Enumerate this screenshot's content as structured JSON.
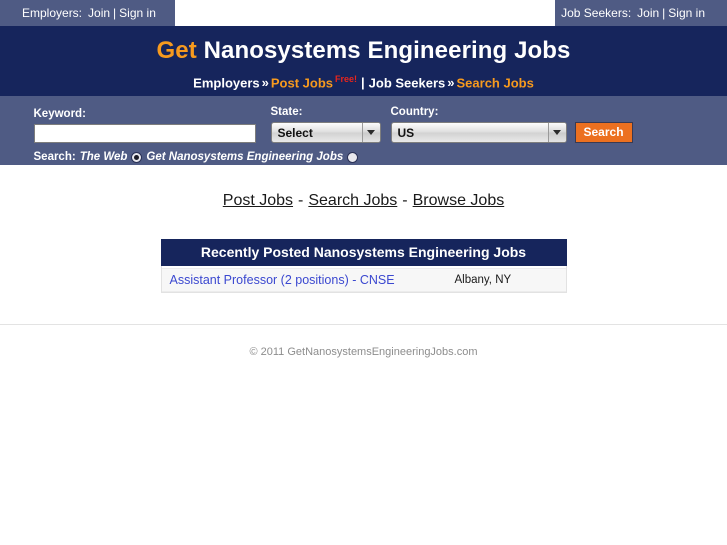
{
  "topbar": {
    "employers": {
      "prefix": "Employers:",
      "join": "Join",
      "separator": "|",
      "signin": "Sign in"
    },
    "jobseekers": {
      "prefix": "Job Seekers:",
      "join": "Join",
      "separator": "|",
      "signin": "Sign in"
    }
  },
  "masthead": {
    "title_accent": "Get",
    "title_rest": " Nanosystems Engineering Jobs",
    "nav": {
      "employers": "Employers",
      "chevron1": "»",
      "post_jobs": "Post Jobs",
      "free_badge": "Free!",
      "pipe": "|",
      "job_seekers": "Job Seekers",
      "chevron2": "»",
      "search_jobs": "Search Jobs"
    }
  },
  "search": {
    "keyword_label": "Keyword:",
    "keyword_value": "",
    "keyword_placeholder": "",
    "state_label": "State:",
    "state_value": "Select",
    "state_options": [
      "Select"
    ],
    "country_label": "Country:",
    "country_value": "US",
    "country_options": [
      "US"
    ],
    "search_button": "Search",
    "scope_prefix": "Search:",
    "scope_web": "The Web",
    "scope_site": "Get Nanosystems Engineering Jobs",
    "scope_web_selected": true,
    "scope_site_selected": false
  },
  "quicknav": {
    "post_jobs": "Post Jobs",
    "dash1": "-",
    "search_jobs": "Search Jobs",
    "dash2": "-",
    "browse_jobs": "Browse Jobs"
  },
  "recent": {
    "heading": "Recently Posted Nanosystems Engineering Jobs",
    "jobs": [
      {
        "title": "Assistant Professor (2 positions) - CNSE",
        "location": "Albany, NY"
      }
    ]
  },
  "footer": {
    "copyright": "© 2011 GetNanosystemsEngineeringJobs.com"
  },
  "colors": {
    "navy": "#16255c",
    "slate": "#4f5b84",
    "orange": "#f79a1e",
    "button_orange": "#ec7020",
    "red": "#e8251c",
    "link_blue": "#3b48d0"
  }
}
